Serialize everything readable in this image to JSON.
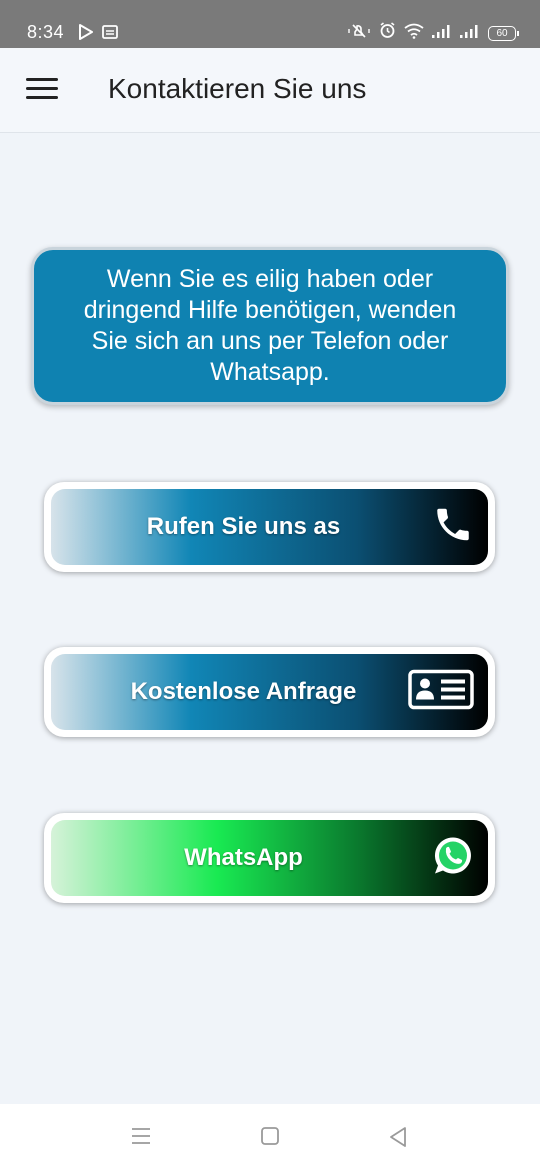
{
  "status_bar": {
    "time": "8:34",
    "battery": "60",
    "left_icons": [
      "play-store-icon",
      "news-icon"
    ],
    "right_icons": [
      "mute-icon",
      "alarm-icon",
      "wifi-icon",
      "signal-icon",
      "signal-icon",
      "battery-icon"
    ]
  },
  "app_bar": {
    "title": "Kontaktieren Sie uns",
    "menu_icon": "hamburger-menu-icon"
  },
  "info": {
    "text": "Wenn Sie es eilig haben oder dringend Hilfe benötigen, wenden Sie sich an uns per Telefon oder Whatsapp."
  },
  "actions": {
    "call": {
      "label": "Rufen Sie uns as",
      "icon": "phone-icon"
    },
    "request": {
      "label": "Kostenlose Anfrage",
      "icon": "contact-card-icon"
    },
    "whatsapp": {
      "label": "WhatsApp",
      "icon": "whatsapp-icon"
    }
  },
  "nav_bar": {
    "icons": [
      "recents-icon",
      "home-icon",
      "back-icon"
    ]
  },
  "colors": {
    "info_card": "#0f82b1",
    "blue_gradient_mid": "#1186b6",
    "green_gradient_mid": "#19ea52",
    "background": "#f0f4f9"
  }
}
